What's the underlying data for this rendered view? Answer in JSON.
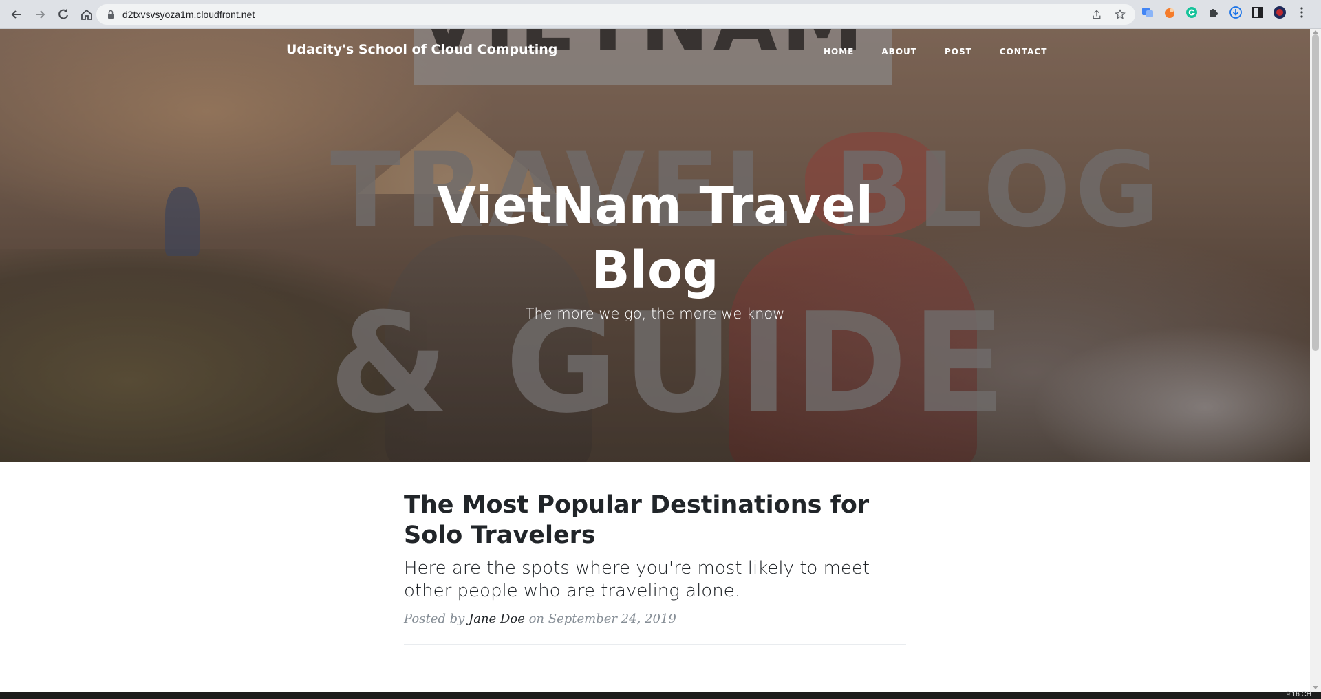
{
  "browser": {
    "url": "d2txvsvsyoza1m.cloudfront.net",
    "icons": [
      "back-icon",
      "forward-icon",
      "reload-icon",
      "home-icon",
      "lock-icon",
      "share-icon",
      "star-icon",
      "translate-icon",
      "extension-icon",
      "grammarly-icon",
      "puzzle-icon",
      "download-icon",
      "sidepanel-icon",
      "profile-avatar",
      "menu-icon"
    ]
  },
  "site": {
    "brand": "Udacity's School of Cloud Computing",
    "nav": [
      {
        "label": "HOME"
      },
      {
        "label": "ABOUT"
      },
      {
        "label": "POST"
      },
      {
        "label": "CONTACT"
      }
    ]
  },
  "hero": {
    "background_text": [
      "VIETNAM",
      "TRAVEL BLOG",
      "& GUIDE"
    ],
    "title": "VietNam Travel Blog",
    "subheading": "The more we go, the more we know"
  },
  "post": {
    "title": "The Most Popular Destinations for Solo Travelers",
    "subtitle": "Here are the spots where you're most likely to meet other people who are traveling alone.",
    "meta_prefix": "Posted by",
    "author": "Jane Doe",
    "meta_on": "on",
    "date": "September 24, 2019"
  },
  "taskbar": {
    "clock": "9:16 CH"
  },
  "colors": {
    "heading": "#212529",
    "meta": "#868e96",
    "chrome_bg": "#dee1e6",
    "omnibox_bg": "#f1f3f4"
  }
}
